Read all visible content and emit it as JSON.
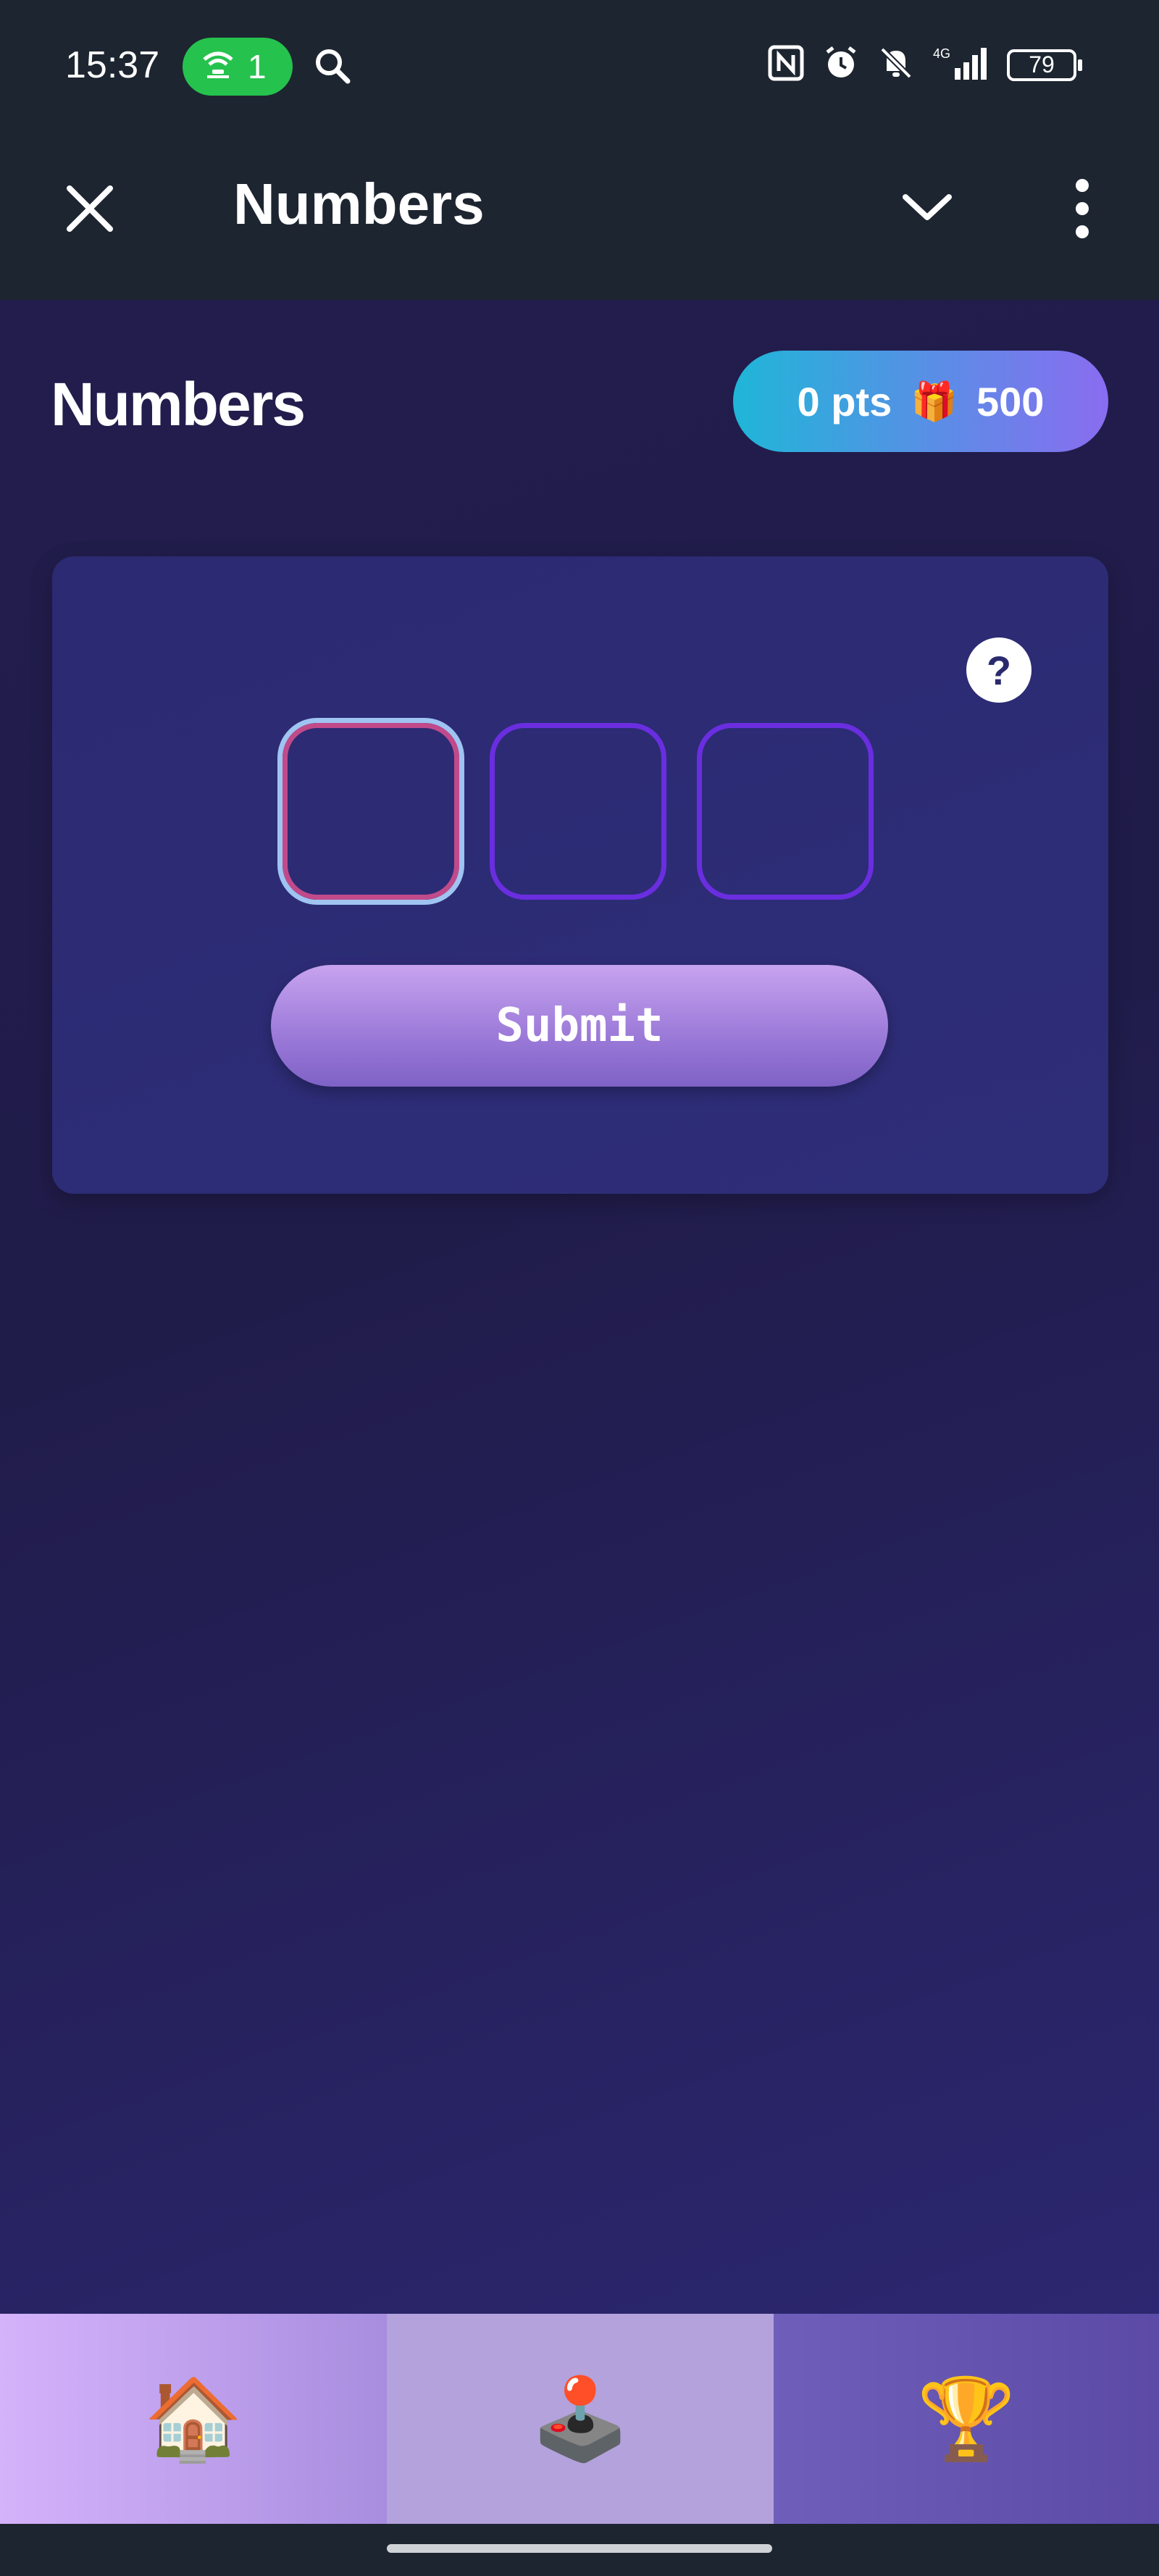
{
  "status_bar": {
    "time": "15:37",
    "hotspot_count": "1",
    "battery": "79",
    "network": "4G"
  },
  "app_bar": {
    "title": "Numbers"
  },
  "game": {
    "title": "Numbers",
    "points": "0 pts",
    "reward": "500",
    "help_label": "?",
    "digits": [
      "",
      "",
      ""
    ],
    "submit_label": "Submit"
  },
  "bottom_nav": {
    "items": [
      {
        "icon": "🏠",
        "name": "home"
      },
      {
        "icon": "🕹️",
        "name": "games"
      },
      {
        "icon": "🏆",
        "name": "trophy"
      }
    ]
  },
  "colors": {
    "accent_gradient_start": "#1fb6d8",
    "accent_gradient_end": "#8a6cf0",
    "digit_border": "#6a2ee0",
    "active_digit_border": "#c14a8a"
  }
}
